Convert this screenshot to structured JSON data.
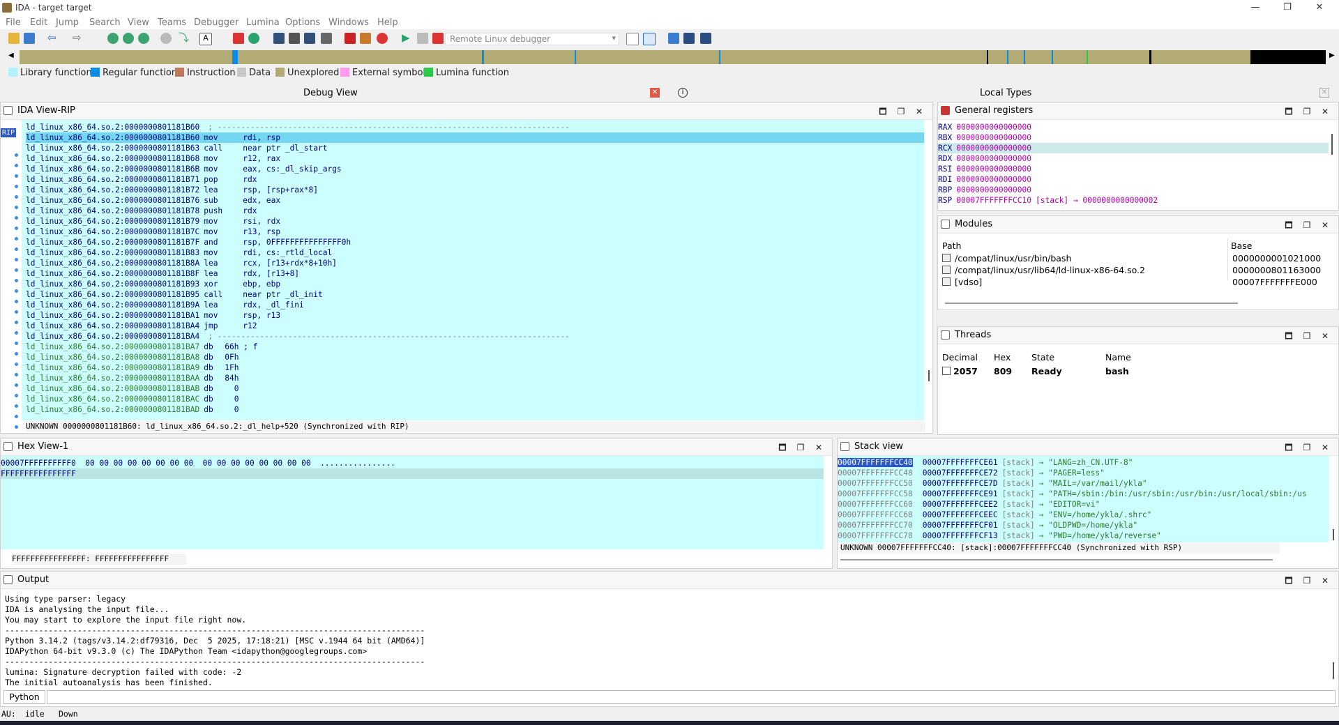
{
  "window": {
    "title": "IDA - target target",
    "min": "—",
    "max": "❐",
    "close": "✕"
  },
  "menu": [
    "File",
    "Edit",
    "Jump",
    "Search",
    "View",
    "Teams",
    "Debugger",
    "Lumina",
    "Options",
    "Windows",
    "Help"
  ],
  "toolbar": {
    "debugger_select": "Remote Linux debugger"
  },
  "legend": [
    {
      "label": "Library function",
      "color": "#b4f0ff"
    },
    {
      "label": "Regular function",
      "color": "#0a8be6"
    },
    {
      "label": "Instruction",
      "color": "#c0785a"
    },
    {
      "label": "Data",
      "color": "#c8c8c8"
    },
    {
      "label": "Unexplored",
      "color": "#b2ab74"
    },
    {
      "label": "External symbol",
      "color": "#ff9cf0"
    },
    {
      "label": "Lumina function",
      "color": "#2cc84a"
    }
  ],
  "tabs": {
    "debug_view": "Debug View",
    "local_types": "Local Types"
  },
  "ida_view": {
    "title": "IDA View-RIP",
    "rip_marker": "RIP",
    "lines": [
      {
        "addr": "ld_linux_x86_64.so.2:0000000801181B60",
        "op": "",
        "args": "; ---------------------------------------------------------------------------",
        "kind": "code"
      },
      {
        "addr": "ld_linux_x86_64.so.2:0000000801181B60",
        "op": "mov",
        "args": "rdi, rsp",
        "kind": "code",
        "hl": true
      },
      {
        "addr": "ld_linux_x86_64.so.2:0000000801181B63",
        "op": "call",
        "args": "near ptr _dl_start",
        "kind": "code"
      },
      {
        "addr": "ld_linux_x86_64.so.2:0000000801181B68",
        "op": "mov",
        "args": "r12, rax",
        "kind": "code"
      },
      {
        "addr": "ld_linux_x86_64.so.2:0000000801181B6B",
        "op": "mov",
        "args": "eax, cs:_dl_skip_args",
        "kind": "code"
      },
      {
        "addr": "ld_linux_x86_64.so.2:0000000801181B71",
        "op": "pop",
        "args": "rdx",
        "kind": "code"
      },
      {
        "addr": "ld_linux_x86_64.so.2:0000000801181B72",
        "op": "lea",
        "args": "rsp, [rsp+rax*8]",
        "kind": "code"
      },
      {
        "addr": "ld_linux_x86_64.so.2:0000000801181B76",
        "op": "sub",
        "args": "edx, eax",
        "kind": "code"
      },
      {
        "addr": "ld_linux_x86_64.so.2:0000000801181B78",
        "op": "push",
        "args": "rdx",
        "kind": "code"
      },
      {
        "addr": "ld_linux_x86_64.so.2:0000000801181B79",
        "op": "mov",
        "args": "rsi, rdx",
        "kind": "code"
      },
      {
        "addr": "ld_linux_x86_64.so.2:0000000801181B7C",
        "op": "mov",
        "args": "r13, rsp",
        "kind": "code"
      },
      {
        "addr": "ld_linux_x86_64.so.2:0000000801181B7F",
        "op": "and",
        "args": "rsp, 0FFFFFFFFFFFFFFF0h",
        "kind": "code"
      },
      {
        "addr": "ld_linux_x86_64.so.2:0000000801181B83",
        "op": "mov",
        "args": "rdi, cs:_rtld_local",
        "kind": "code"
      },
      {
        "addr": "ld_linux_x86_64.so.2:0000000801181B8A",
        "op": "lea",
        "args": "rcx, [r13+rdx*8+10h]",
        "kind": "code"
      },
      {
        "addr": "ld_linux_x86_64.so.2:0000000801181B8F",
        "op": "lea",
        "args": "rdx, [r13+8]",
        "kind": "code"
      },
      {
        "addr": "ld_linux_x86_64.so.2:0000000801181B93",
        "op": "xor",
        "args": "ebp, ebp",
        "kind": "code"
      },
      {
        "addr": "ld_linux_x86_64.so.2:0000000801181B95",
        "op": "call",
        "args": "near ptr _dl_init",
        "kind": "code"
      },
      {
        "addr": "ld_linux_x86_64.so.2:0000000801181B9A",
        "op": "lea",
        "args": "rdx, _dl_fini",
        "kind": "code"
      },
      {
        "addr": "ld_linux_x86_64.so.2:0000000801181BA1",
        "op": "mov",
        "args": "rsp, r13",
        "kind": "code"
      },
      {
        "addr": "ld_linux_x86_64.so.2:0000000801181BA4",
        "op": "jmp",
        "args": "r12",
        "kind": "code"
      },
      {
        "addr": "ld_linux_x86_64.so.2:0000000801181BA4",
        "op": "",
        "args": "; ---------------------------------------------------------------------------",
        "kind": "code"
      },
      {
        "addr": "ld_linux_x86_64.so.2:0000000801181BA7",
        "op": "db",
        "args": "66h ; f",
        "kind": "data"
      },
      {
        "addr": "ld_linux_x86_64.so.2:0000000801181BA8",
        "op": "db",
        "args": "0Fh",
        "kind": "data"
      },
      {
        "addr": "ld_linux_x86_64.so.2:0000000801181BA9",
        "op": "db",
        "args": "1Fh",
        "kind": "data"
      },
      {
        "addr": "ld_linux_x86_64.so.2:0000000801181BAA",
        "op": "db",
        "args": "84h",
        "kind": "data"
      },
      {
        "addr": "ld_linux_x86_64.so.2:0000000801181BAB",
        "op": "db",
        "args": "  0",
        "kind": "data"
      },
      {
        "addr": "ld_linux_x86_64.so.2:0000000801181BAC",
        "op": "db",
        "args": "  0",
        "kind": "data"
      },
      {
        "addr": "ld_linux_x86_64.so.2:0000000801181BAD",
        "op": "db",
        "args": "  0",
        "kind": "data"
      }
    ],
    "status": "UNKNOWN 0000000801181B60: ld_linux_x86_64.so.2:_dl_help+520 (Synchronized with RIP)"
  },
  "registers": {
    "title": "General registers",
    "rows": [
      {
        "name": "RAX",
        "value": "0000000000000000",
        "extra": ""
      },
      {
        "name": "RBX",
        "value": "0000000000000000",
        "extra": ""
      },
      {
        "name": "RCX",
        "value": "0000000000000000",
        "extra": ""
      },
      {
        "name": "RDX",
        "value": "0000000000000000",
        "extra": ""
      },
      {
        "name": "RSI",
        "value": "0000000000000000",
        "extra": ""
      },
      {
        "name": "RDI",
        "value": "0000000000000000",
        "extra": ""
      },
      {
        "name": "RBP",
        "value": "0000000000000000",
        "extra": ""
      },
      {
        "name": "RSP",
        "value": "00007FFFFFFFCC10",
        "extra": "[stack] → 0000000000000002"
      }
    ]
  },
  "modules": {
    "title": "Modules",
    "headers": [
      "Path",
      "Base"
    ],
    "rows": [
      {
        "path": "/compat/linux/usr/bin/bash",
        "base": "0000000001021000"
      },
      {
        "path": "/compat/linux/usr/lib64/ld-linux-x86-64.so.2",
        "base": "0000000801163000"
      },
      {
        "path": "[vdso]",
        "base": "00007FFFFFFFE000"
      }
    ]
  },
  "threads": {
    "title": "Threads",
    "headers": [
      "Decimal",
      "Hex",
      "State",
      "Name"
    ],
    "rows": [
      {
        "decimal": "2057",
        "hex": "809",
        "state": "Ready",
        "name": "bash"
      }
    ]
  },
  "hex_view": {
    "title": "Hex View-1",
    "rows": [
      {
        "addr": "00007FFFFFFFFFF0",
        "bytes": "00 00 00 00 00 00 00 00  00 00 00 00 00 00 00 00",
        "ascii": "................"
      },
      {
        "addr": "FFFFFFFFFFFFFFFF",
        "bytes": "",
        "ascii": ""
      }
    ],
    "status": "FFFFFFFFFFFFFFFF: FFFFFFFFFFFFFFFF"
  },
  "stack_view": {
    "title": "Stack view",
    "rows": [
      {
        "addr": "00007FFFFFFFCC40",
        "ptr": "00007FFFFFFFCE61",
        "seg": "[stack]",
        "val": "→ \"LANG=zh_CN.UTF-8\""
      },
      {
        "addr": "00007FFFFFFFCC48",
        "ptr": "00007FFFFFFFCE72",
        "seg": "[stack]",
        "val": "→ \"PAGER=less\""
      },
      {
        "addr": "00007FFFFFFFCC50",
        "ptr": "00007FFFFFFFCE7D",
        "seg": "[stack]",
        "val": "→ \"MAIL=/var/mail/ykla\""
      },
      {
        "addr": "00007FFFFFFFCC58",
        "ptr": "00007FFFFFFFCE91",
        "seg": "[stack]",
        "val": "→ \"PATH=/sbin:/bin:/usr/sbin:/usr/bin:/usr/local/sbin:/us"
      },
      {
        "addr": "00007FFFFFFFCC60",
        "ptr": "00007FFFFFFFCEE2",
        "seg": "[stack]",
        "val": "→ \"EDITOR=vi\""
      },
      {
        "addr": "00007FFFFFFFCC68",
        "ptr": "00007FFFFFFFCEEC",
        "seg": "[stack]",
        "val": "→ \"ENV=/home/ykla/.shrc\""
      },
      {
        "addr": "00007FFFFFFFCC70",
        "ptr": "00007FFFFFFFCF01",
        "seg": "[stack]",
        "val": "→ \"OLDPWD=/home/ykla\""
      },
      {
        "addr": "00007FFFFFFFCC78",
        "ptr": "00007FFFFFFFCF13",
        "seg": "[stack]",
        "val": "→ \"PWD=/home/ykla/reverse\""
      }
    ],
    "status": "UNKNOWN 00007FFFFFFFCC40: [stack]:00007FFFFFFFCC40 (Synchronized with RSP)"
  },
  "output": {
    "title": "Output",
    "lines": [
      "Using type parser: legacy",
      "IDA is analysing the input file...",
      "You may start to explore the input file right now.",
      "---------------------------------------------------------------------------------------",
      "Python 3.14.2 (tags/v3.14.2:df79316, Dec  5 2025, 17:18:21) [MSC v.1944 64 bit (AMD64)]",
      "IDAPython 64-bit v9.3.0 (c) The IDAPython Team <idapython@googlegroups.com>",
      "---------------------------------------------------------------------------------------",
      "lumina: Signature decryption failed with code: -2",
      "The initial autoanalysis has been finished."
    ],
    "cli_label": "Python"
  },
  "statusbar": {
    "au_label": "AU:",
    "au_state": "idle",
    "direction": "Down"
  }
}
